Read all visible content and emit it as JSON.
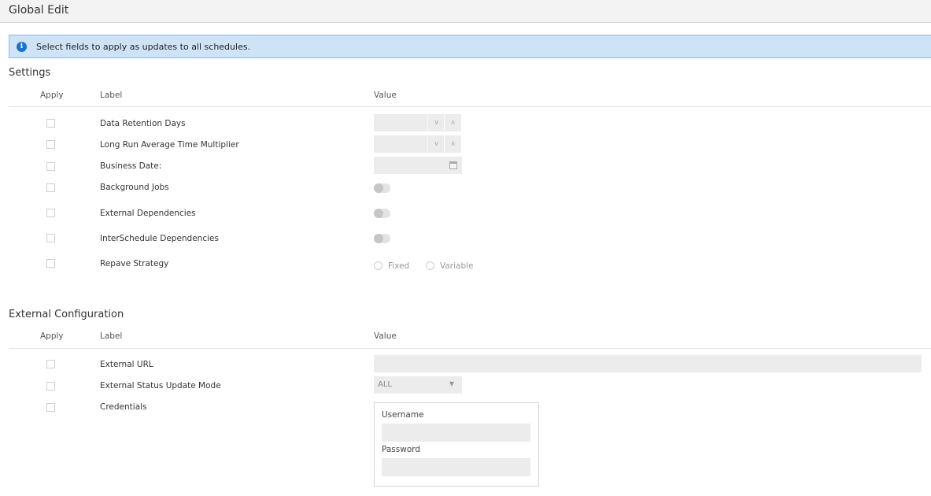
{
  "window": {
    "title": "Global Edit"
  },
  "info": {
    "icon": "info-icon",
    "message": "Select fields to apply as updates to all schedules."
  },
  "settings": {
    "title": "Settings",
    "columns": {
      "apply": "Apply",
      "label": "Label",
      "value": "Value"
    },
    "rows": [
      {
        "label": "Data Retention Days",
        "control": "number-spinner"
      },
      {
        "label": "Long Run Average Time Multiplier",
        "control": "number-spinner"
      },
      {
        "label": "Business Date:",
        "control": "date-picker"
      },
      {
        "label": "Background Jobs",
        "control": "toggle",
        "on": false
      },
      {
        "label": "External Dependencies",
        "control": "toggle",
        "on": false
      },
      {
        "label": "InterSchedule Dependencies",
        "control": "toggle",
        "on": false
      },
      {
        "label": "Repave Strategy",
        "control": "radio-group",
        "options": [
          "Fixed",
          "Variable"
        ],
        "selected": null
      }
    ]
  },
  "external": {
    "title": "External Configuration",
    "columns": {
      "apply": "Apply",
      "label": "Label",
      "value": "Value"
    },
    "rows": [
      {
        "label": "External URL",
        "value": ""
      },
      {
        "label": "External Status Update Mode",
        "value": "ALL"
      },
      {
        "label": "Credentials"
      }
    ],
    "credentials": {
      "username_label": "Username",
      "username_value": "",
      "password_label": "Password",
      "password_value": ""
    }
  },
  "icons": {
    "spinner_down": "chevron-down-icon",
    "spinner_up": "chevron-up-icon",
    "calendar": "calendar-icon",
    "select_arrow": "caret-down-icon"
  },
  "colors": {
    "info_background": "#cfe3f7",
    "info_border": "#8fb9e6",
    "info_icon": "#1a73c9"
  }
}
